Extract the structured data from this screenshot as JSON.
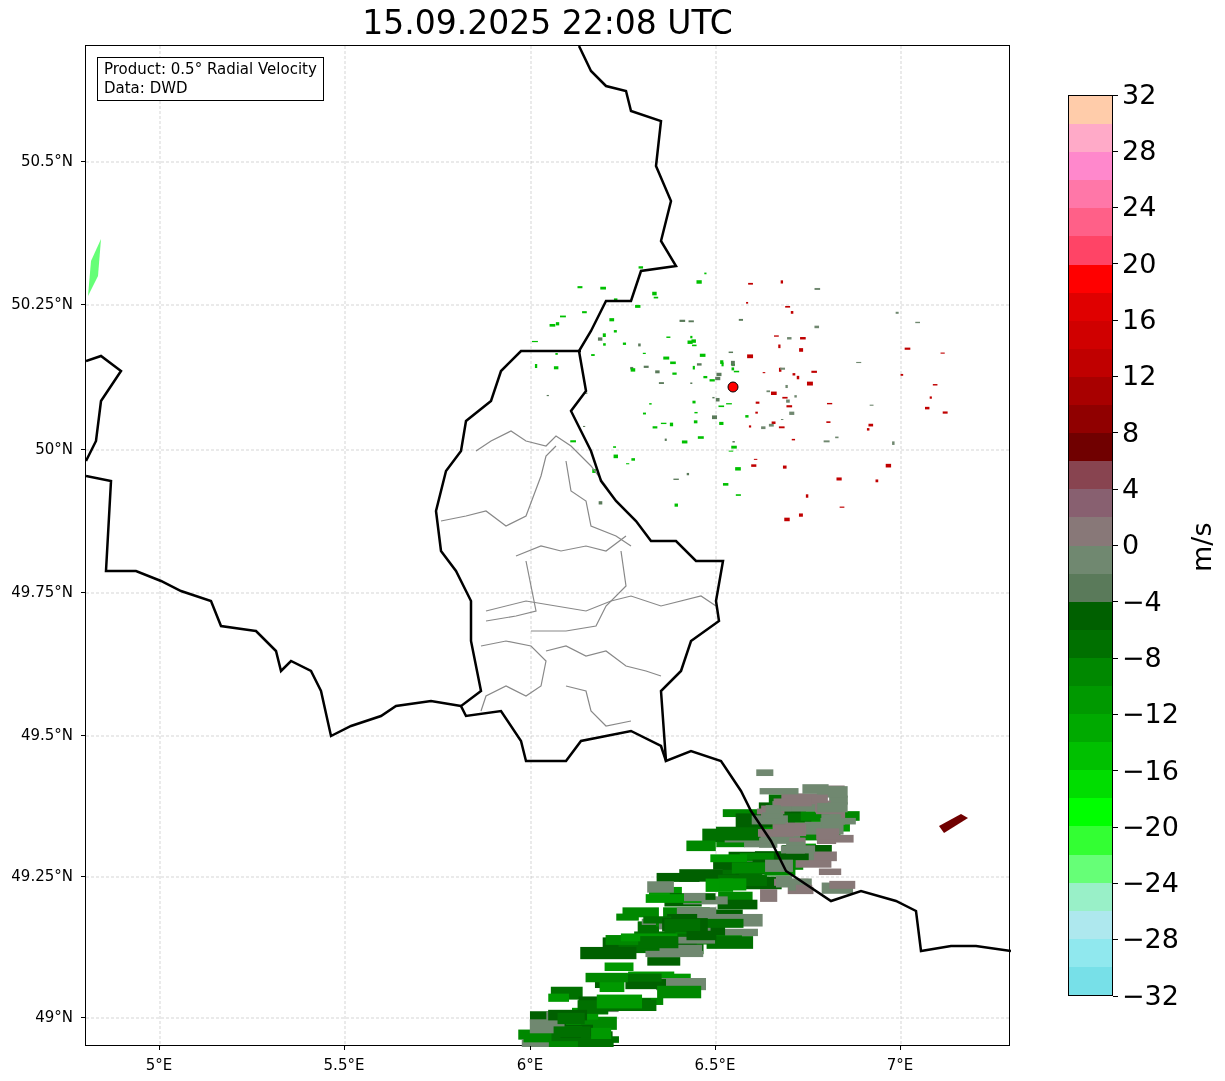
{
  "title": "15.09.2025 22:08 UTC",
  "info_box": {
    "lines": [
      "Product: 0.5° Radial Velocity",
      "Data: DWD"
    ]
  },
  "map": {
    "lat_ticks": [
      "50.5°N",
      "50.25°N",
      "50°N",
      "49.75°N",
      "49.5°N",
      "49.25°N",
      "49°N"
    ],
    "lon_ticks": [
      "5°E",
      "5.5°E",
      "6°E",
      "6.5°E",
      "7°E"
    ]
  },
  "colorbar": {
    "label": "m/s",
    "ticks": [
      "32",
      "28",
      "24",
      "20",
      "16",
      "12",
      "8",
      "4",
      "0",
      "−4",
      "−8",
      "−12",
      "−16",
      "−20",
      "−24",
      "−28",
      "−32"
    ],
    "bands": [
      {
        "color": "#ffccaa"
      },
      {
        "color": "#ffaac8"
      },
      {
        "color": "#ff88cc"
      },
      {
        "color": "#ff77a8"
      },
      {
        "color": "#ff6088"
      },
      {
        "color": "#ff4466"
      },
      {
        "color": "#ff0000"
      },
      {
        "color": "#e00000"
      },
      {
        "color": "#d00000"
      },
      {
        "color": "#c00000"
      },
      {
        "color": "#a80000"
      },
      {
        "color": "#900000"
      },
      {
        "color": "#700000"
      },
      {
        "color": "#884450"
      },
      {
        "color": "#886070"
      },
      {
        "color": "#887878"
      },
      {
        "color": "#708870"
      },
      {
        "color": "#5a7a5a"
      },
      {
        "color": "#006000"
      },
      {
        "color": "#007000"
      },
      {
        "color": "#008800"
      },
      {
        "color": "#009900"
      },
      {
        "color": "#00aa00"
      },
      {
        "color": "#00c000"
      },
      {
        "color": "#00dd00"
      },
      {
        "color": "#00ff00"
      },
      {
        "color": "#33ff33"
      },
      {
        "color": "#66ff77"
      },
      {
        "color": "#99f0c8"
      },
      {
        "color": "#aee8ee"
      },
      {
        "color": "#90e8ee"
      },
      {
        "color": "#77e0e8"
      }
    ]
  }
}
